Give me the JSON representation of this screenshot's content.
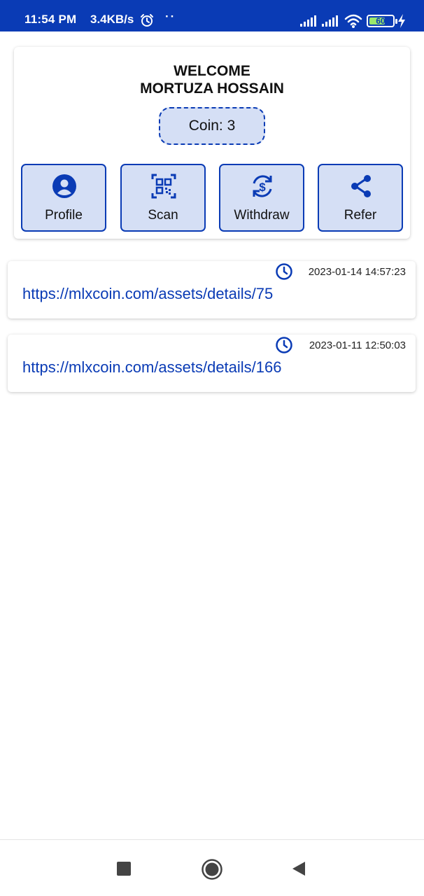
{
  "status_bar": {
    "time": "11:54 PM",
    "speed": "3.4KB/s",
    "dots": "··",
    "battery": "60",
    "icons": [
      "alarm-icon",
      "signal-icon",
      "signal-icon",
      "wifi-icon",
      "battery-icon",
      "charging-bolt-icon"
    ]
  },
  "welcome": {
    "title": "WELCOME",
    "name": "MORTUZA HOSSAIN",
    "coin_label": "Coin: 3"
  },
  "actions": [
    {
      "label": "Profile",
      "icon": "profile-icon"
    },
    {
      "label": "Scan",
      "icon": "qr-scan-icon"
    },
    {
      "label": "Withdraw",
      "icon": "withdraw-icon"
    },
    {
      "label": "Refer",
      "icon": "share-icon"
    }
  ],
  "history": [
    {
      "timestamp": "2023-01-14 14:57:23",
      "url": "https://mlxcoin.com/assets/details/75"
    },
    {
      "timestamp": "2023-01-11 12:50:03",
      "url": "https://mlxcoin.com/assets/details/166"
    }
  ],
  "nav": {
    "icons": [
      "recent-apps-icon",
      "home-icon",
      "back-icon"
    ]
  },
  "colors": {
    "primary": "#0a3bb5",
    "button_fill": "#d5dff5",
    "text": "#111111"
  }
}
